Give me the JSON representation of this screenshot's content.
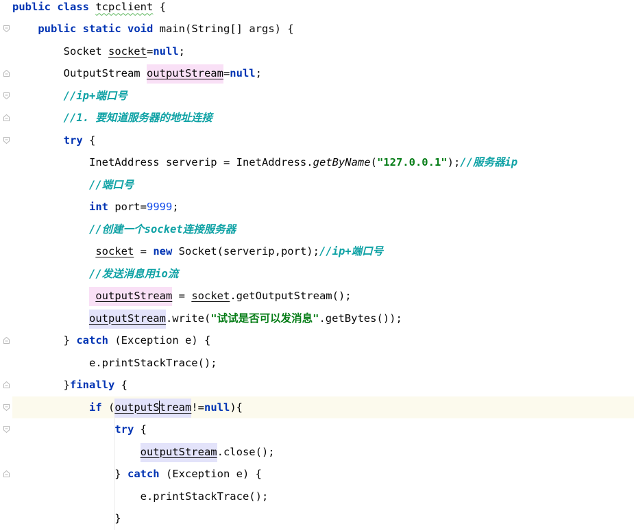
{
  "lines": [
    {
      "id": "l1",
      "segments": [
        {
          "c": "kw",
          "t": "public"
        },
        {
          "t": " "
        },
        {
          "c": "kw",
          "t": "class"
        },
        {
          "t": " "
        },
        {
          "c": "wavy",
          "t": "tcpclient"
        },
        {
          "t": " {"
        }
      ]
    },
    {
      "id": "l2",
      "segments": [
        {
          "t": "    "
        },
        {
          "c": "kw",
          "t": "public"
        },
        {
          "t": " "
        },
        {
          "c": "kw",
          "t": "static"
        },
        {
          "t": " "
        },
        {
          "c": "kw",
          "t": "void"
        },
        {
          "t": " main(String[] args) {"
        }
      ]
    },
    {
      "id": "l3",
      "segments": [
        {
          "t": "        Socket "
        },
        {
          "c": "ul",
          "t": "socket"
        },
        {
          "t": "="
        },
        {
          "c": "kw",
          "t": "null"
        },
        {
          "t": ";"
        }
      ]
    },
    {
      "id": "l4",
      "segments": [
        {
          "t": "        OutputStream "
        },
        {
          "c": "ul hl-pink",
          "t": "outputStream"
        },
        {
          "t": "="
        },
        {
          "c": "kw",
          "t": "null"
        },
        {
          "t": ";"
        }
      ]
    },
    {
      "id": "l5",
      "segments": [
        {
          "t": "        "
        },
        {
          "c": "cmt",
          "t": "//ip+端口号"
        }
      ]
    },
    {
      "id": "l6",
      "segments": [
        {
          "t": "        "
        },
        {
          "c": "cmt",
          "t": "//1. 要知道服务器的地址连接"
        }
      ]
    },
    {
      "id": "l7",
      "segments": [
        {
          "t": "        "
        },
        {
          "c": "kw",
          "t": "try"
        },
        {
          "t": " {"
        }
      ]
    },
    {
      "id": "l8",
      "segments": [
        {
          "t": "            InetAddress serverip = InetAddress."
        },
        {
          "c": "it",
          "t": "getByName"
        },
        {
          "t": "("
        },
        {
          "c": "str",
          "t": "\"127.0.0.1\""
        },
        {
          "t": ");"
        },
        {
          "c": "cmt",
          "t": "//服务器ip"
        }
      ]
    },
    {
      "id": "l9",
      "segments": [
        {
          "t": "            "
        },
        {
          "c": "cmt",
          "t": "//端口号"
        }
      ]
    },
    {
      "id": "l10",
      "segments": [
        {
          "t": "            "
        },
        {
          "c": "kw",
          "t": "int"
        },
        {
          "t": " port="
        },
        {
          "c": "num",
          "t": "9999"
        },
        {
          "t": ";"
        }
      ]
    },
    {
      "id": "l11",
      "segments": [
        {
          "t": "            "
        },
        {
          "c": "cmt",
          "t": "//创建一个socket连接服务器"
        }
      ]
    },
    {
      "id": "l12",
      "segments": [
        {
          "t": "             "
        },
        {
          "c": "ul",
          "t": "socket"
        },
        {
          "t": " = "
        },
        {
          "c": "kw",
          "t": "new"
        },
        {
          "t": " Socket(serverip,port);"
        },
        {
          "c": "cmt",
          "t": "//ip+端口号"
        }
      ]
    },
    {
      "id": "l13",
      "segments": [
        {
          "t": "            "
        },
        {
          "c": "cmt",
          "t": "//发送消息用io流"
        }
      ]
    },
    {
      "id": "l14",
      "segments": [
        {
          "t": "            "
        },
        {
          "c": "hl-pink",
          "t": " "
        },
        {
          "c": "ul hl-pink",
          "t": "outputStream"
        },
        {
          "t": " = "
        },
        {
          "c": "ul",
          "t": "socket"
        },
        {
          "t": ".getOutputStream();"
        }
      ]
    },
    {
      "id": "l15",
      "segments": [
        {
          "t": "            "
        },
        {
          "c": "ul hl-blue",
          "t": "outputStream"
        },
        {
          "t": ".write("
        },
        {
          "c": "str",
          "t": "\"试试是否可以发消息\""
        },
        {
          "t": ".getBytes());"
        }
      ]
    },
    {
      "id": "l16",
      "segments": [
        {
          "t": "        } "
        },
        {
          "c": "kw",
          "t": "catch"
        },
        {
          "t": " (Exception e) {"
        }
      ]
    },
    {
      "id": "l17",
      "segments": [
        {
          "t": "            e.printStackTrace();"
        }
      ]
    },
    {
      "id": "l18",
      "segments": [
        {
          "t": "        }"
        },
        {
          "c": "kw",
          "t": "finally"
        },
        {
          "t": " {"
        }
      ]
    },
    {
      "id": "l19",
      "segments": [
        {
          "t": "            "
        },
        {
          "c": "kw",
          "t": "if"
        },
        {
          "t": " ("
        },
        {
          "c": "ul hl-blue",
          "t": "outputS"
        },
        {
          "c": "caret",
          "t": ""
        },
        {
          "c": "ul hl-blue",
          "t": "tream"
        },
        {
          "t": "!="
        },
        {
          "c": "kw",
          "t": "null"
        },
        {
          "t": "){"
        }
      ]
    },
    {
      "id": "l20",
      "segments": [
        {
          "t": "                "
        },
        {
          "c": "kw",
          "t": "try"
        },
        {
          "t": " {"
        }
      ]
    },
    {
      "id": "l21",
      "segments": [
        {
          "t": "                    "
        },
        {
          "c": "ul hl-blue",
          "t": "outputStream"
        },
        {
          "t": ".close();"
        }
      ]
    },
    {
      "id": "l22",
      "segments": [
        {
          "t": "                } "
        },
        {
          "c": "kw",
          "t": "catch"
        },
        {
          "t": " (Exception e) {"
        }
      ]
    },
    {
      "id": "l23",
      "segments": [
        {
          "t": "                    e.printStackTrace();"
        }
      ]
    },
    {
      "id": "l24",
      "segments": [
        {
          "t": "                }"
        }
      ]
    }
  ],
  "current_line_index": 18,
  "colors": {
    "keyword": "#0033b3",
    "string": "#067d17",
    "number": "#1750eb",
    "comment": "#0fa2a5",
    "current_line": "#fcfaed",
    "write_highlight": "#f9e0f6",
    "read_highlight": "#e3e3fa"
  },
  "fold_markers": [
    {
      "line": 1,
      "kind": "open"
    },
    {
      "line": 3,
      "kind": "end"
    },
    {
      "line": 4,
      "kind": "open"
    },
    {
      "line": 5,
      "kind": "end"
    },
    {
      "line": 6,
      "kind": "open"
    },
    {
      "line": 15,
      "kind": "end"
    },
    {
      "line": 17,
      "kind": "end"
    },
    {
      "line": 18,
      "kind": "open"
    },
    {
      "line": 19,
      "kind": "open"
    },
    {
      "line": 21,
      "kind": "end"
    }
  ]
}
